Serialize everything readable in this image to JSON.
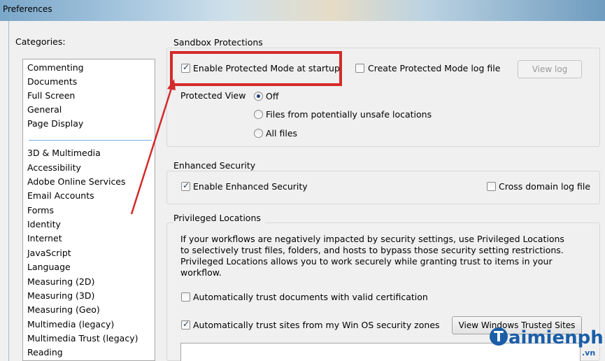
{
  "window": {
    "title": "Preferences"
  },
  "categories": {
    "label": "Categories:",
    "group1": [
      "Commenting",
      "Documents",
      "Full Screen",
      "General",
      "Page Display"
    ],
    "group2": [
      "3D & Multimedia",
      "Accessibility",
      "Adobe Online Services",
      "Email Accounts",
      "Forms",
      "Identity",
      "Internet",
      "JavaScript",
      "Language",
      "Measuring (2D)",
      "Measuring (3D)",
      "Measuring (Geo)",
      "Multimedia (legacy)",
      "Multimedia Trust (legacy)",
      "Reading"
    ]
  },
  "sandbox": {
    "title": "Sandbox Protections",
    "enable_protected_mode": {
      "label": "Enable Protected Mode at startup",
      "checked": true
    },
    "create_log": {
      "label": "Create Protected Mode log file",
      "checked": false
    },
    "view_log_button": "View log",
    "protected_view_label": "Protected View",
    "protected_view_options": [
      {
        "label": "Off",
        "selected": true
      },
      {
        "label": "Files from potentially unsafe locations",
        "selected": false
      },
      {
        "label": "All files",
        "selected": false
      }
    ]
  },
  "enhanced": {
    "title": "Enhanced Security",
    "enable_enhanced": {
      "label": "Enable Enhanced Security",
      "checked": true
    },
    "cross_domain": {
      "label": "Cross domain log file",
      "checked": false
    }
  },
  "privileged": {
    "title": "Privileged Locations",
    "description": "If your workflows are negatively impacted by security settings, use Privileged Locations to selectively trust files, folders, and hosts to bypass those security setting restrictions. Privileged Locations allows you to work securely while granting trust to items in your workflow.",
    "auto_trust_cert": {
      "label": "Automatically trust documents with valid certification",
      "checked": false
    },
    "auto_trust_win": {
      "label": "Automatically trust sites from my Win OS security zones",
      "checked": true
    },
    "view_trusted_button": "View Windows Trusted Sites"
  },
  "watermark": {
    "text": "aimienphi",
    "letter": "T",
    "sub": ".vn"
  },
  "colors": {
    "highlight": "#d42a2a",
    "selection_blue": "#1e3f7a"
  }
}
